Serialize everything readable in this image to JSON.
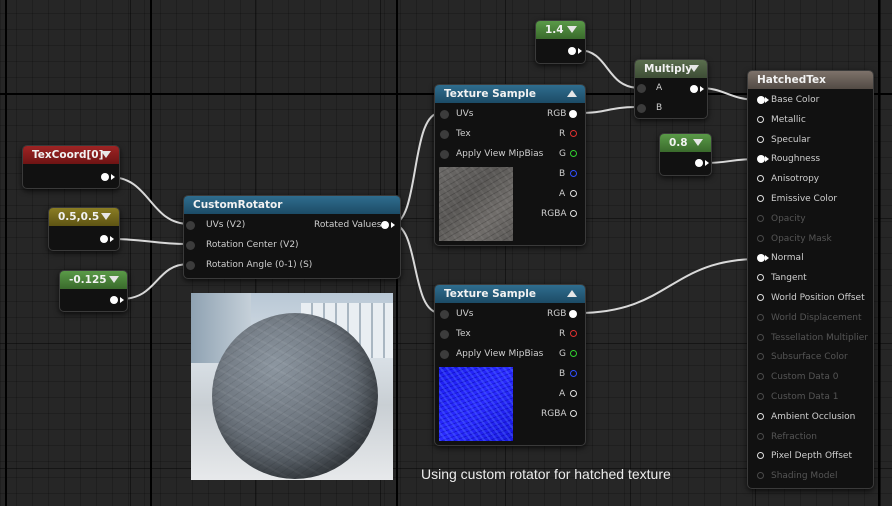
{
  "caption": "Using custom rotator for hatched texture",
  "colors": {
    "texcoord_header": "#8e1b1b",
    "vector2_header": "#7c6f1e",
    "scalar_header": "#4e8a3e",
    "texture_header": "#1c5b7c",
    "material_header": "#6f655e"
  },
  "texcoord": {
    "title": "TexCoord[0]"
  },
  "const2": {
    "title": "0.5,0.5"
  },
  "const_neg": {
    "title": "-0.125"
  },
  "const_14": {
    "title": "1.4"
  },
  "const_08": {
    "title": "0.8"
  },
  "multiply": {
    "title": "Multiply",
    "inputs": [
      "A",
      "B"
    ]
  },
  "rotator": {
    "title": "CustomRotator",
    "inputs": [
      "UVs (V2)",
      "Rotation Center (V2)",
      "Rotation Angle (0-1) (S)"
    ],
    "output": "Rotated Values"
  },
  "texture1": {
    "title": "Texture Sample",
    "inputs": [
      "UVs",
      "Tex",
      "Apply View MipBias"
    ],
    "outputs": [
      "RGB",
      "R",
      "G",
      "B",
      "A",
      "RGBA"
    ],
    "output_colors": [
      "#ffffff",
      "#e03030",
      "#30d030",
      "#3050ff",
      "#e0e0e0",
      "#e0e0e0"
    ]
  },
  "texture2": {
    "title": "Texture Sample",
    "inputs": [
      "UVs",
      "Tex",
      "Apply View MipBias"
    ],
    "outputs": [
      "RGB",
      "R",
      "G",
      "B",
      "A",
      "RGBA"
    ],
    "output_colors": [
      "#ffffff",
      "#e03030",
      "#30d030",
      "#3050ff",
      "#e0e0e0",
      "#e0e0e0"
    ]
  },
  "material": {
    "title": "HatchedTex",
    "inputs": [
      {
        "label": "Base Color",
        "enabled": true,
        "connected": true
      },
      {
        "label": "Metallic",
        "enabled": true,
        "connected": false
      },
      {
        "label": "Specular",
        "enabled": true,
        "connected": false
      },
      {
        "label": "Roughness",
        "enabled": true,
        "connected": true
      },
      {
        "label": "Anisotropy",
        "enabled": true,
        "connected": false
      },
      {
        "label": "Emissive Color",
        "enabled": true,
        "connected": false
      },
      {
        "label": "Opacity",
        "enabled": false,
        "connected": false
      },
      {
        "label": "Opacity Mask",
        "enabled": false,
        "connected": false
      },
      {
        "label": "Normal",
        "enabled": true,
        "connected": true
      },
      {
        "label": "Tangent",
        "enabled": true,
        "connected": false
      },
      {
        "label": "World Position Offset",
        "enabled": true,
        "connected": false
      },
      {
        "label": "World Displacement",
        "enabled": false,
        "connected": false
      },
      {
        "label": "Tessellation Multiplier",
        "enabled": false,
        "connected": false
      },
      {
        "label": "Subsurface Color",
        "enabled": false,
        "connected": false
      },
      {
        "label": "Custom Data 0",
        "enabled": false,
        "connected": false
      },
      {
        "label": "Custom Data 1",
        "enabled": false,
        "connected": false
      },
      {
        "label": "Ambient Occlusion",
        "enabled": true,
        "connected": false
      },
      {
        "label": "Refraction",
        "enabled": false,
        "connected": false
      },
      {
        "label": "Pixel Depth Offset",
        "enabled": true,
        "connected": false
      },
      {
        "label": "Shading Model",
        "enabled": false,
        "connected": false
      }
    ]
  }
}
